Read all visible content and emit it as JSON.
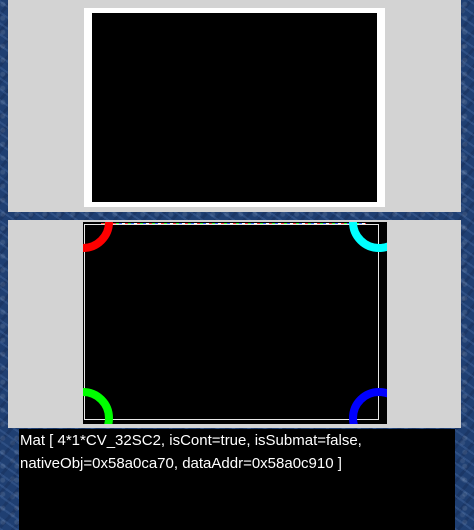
{
  "output": {
    "mat_info": "Mat [ 4*1*CV_32SC2, isCont=true, isSubmat=false,\nnativeObj=0x58a0ca70, dataAddr=0x58a0c910 ]"
  },
  "colors": {
    "corner_top_left": "#ff0000",
    "corner_top_right": "#00ffff",
    "corner_bottom_left": "#00ff00",
    "corner_bottom_right": "#0000ff",
    "panel_background": "#d3d3d3",
    "image_background": "#000000"
  }
}
